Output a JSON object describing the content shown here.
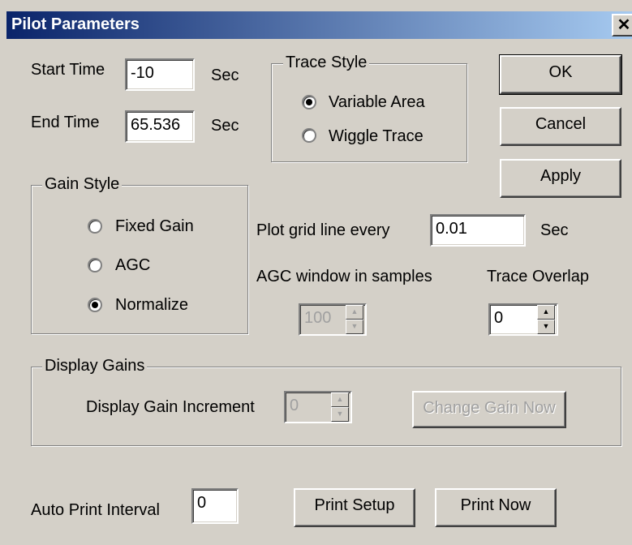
{
  "dialog": {
    "title": "Pilot Parameters",
    "close_label": "✕"
  },
  "time": {
    "start_label": "Start Time",
    "start_value": "-10",
    "start_unit": "Sec",
    "end_label": "End Time",
    "end_value": "65.536",
    "end_unit": "Sec"
  },
  "trace_style": {
    "legend": "Trace Style",
    "options": [
      {
        "label": "Variable Area",
        "selected": true
      },
      {
        "label": "Wiggle Trace",
        "selected": false
      }
    ]
  },
  "buttons": {
    "ok": "OK",
    "cancel": "Cancel",
    "apply": "Apply",
    "print_setup": "Print Setup",
    "print_now": "Print Now",
    "change_gain": "Change Gain Now"
  },
  "gain_style": {
    "legend": "Gain Style",
    "options": [
      {
        "label": "Fixed Gain",
        "selected": false
      },
      {
        "label": "AGC",
        "selected": false
      },
      {
        "label": "Normalize",
        "selected": true
      }
    ]
  },
  "grid": {
    "label": "Plot grid  line every",
    "value": "0.01",
    "unit": "Sec"
  },
  "agc": {
    "label": "AGC window in samples",
    "value": "100"
  },
  "overlap": {
    "label": "Trace Overlap",
    "value": "0"
  },
  "display_gains": {
    "legend": "Display Gains",
    "increment_label": "Display Gain Increment",
    "increment_value": "0"
  },
  "auto_print": {
    "label": "Auto Print Interval",
    "value": "0"
  }
}
